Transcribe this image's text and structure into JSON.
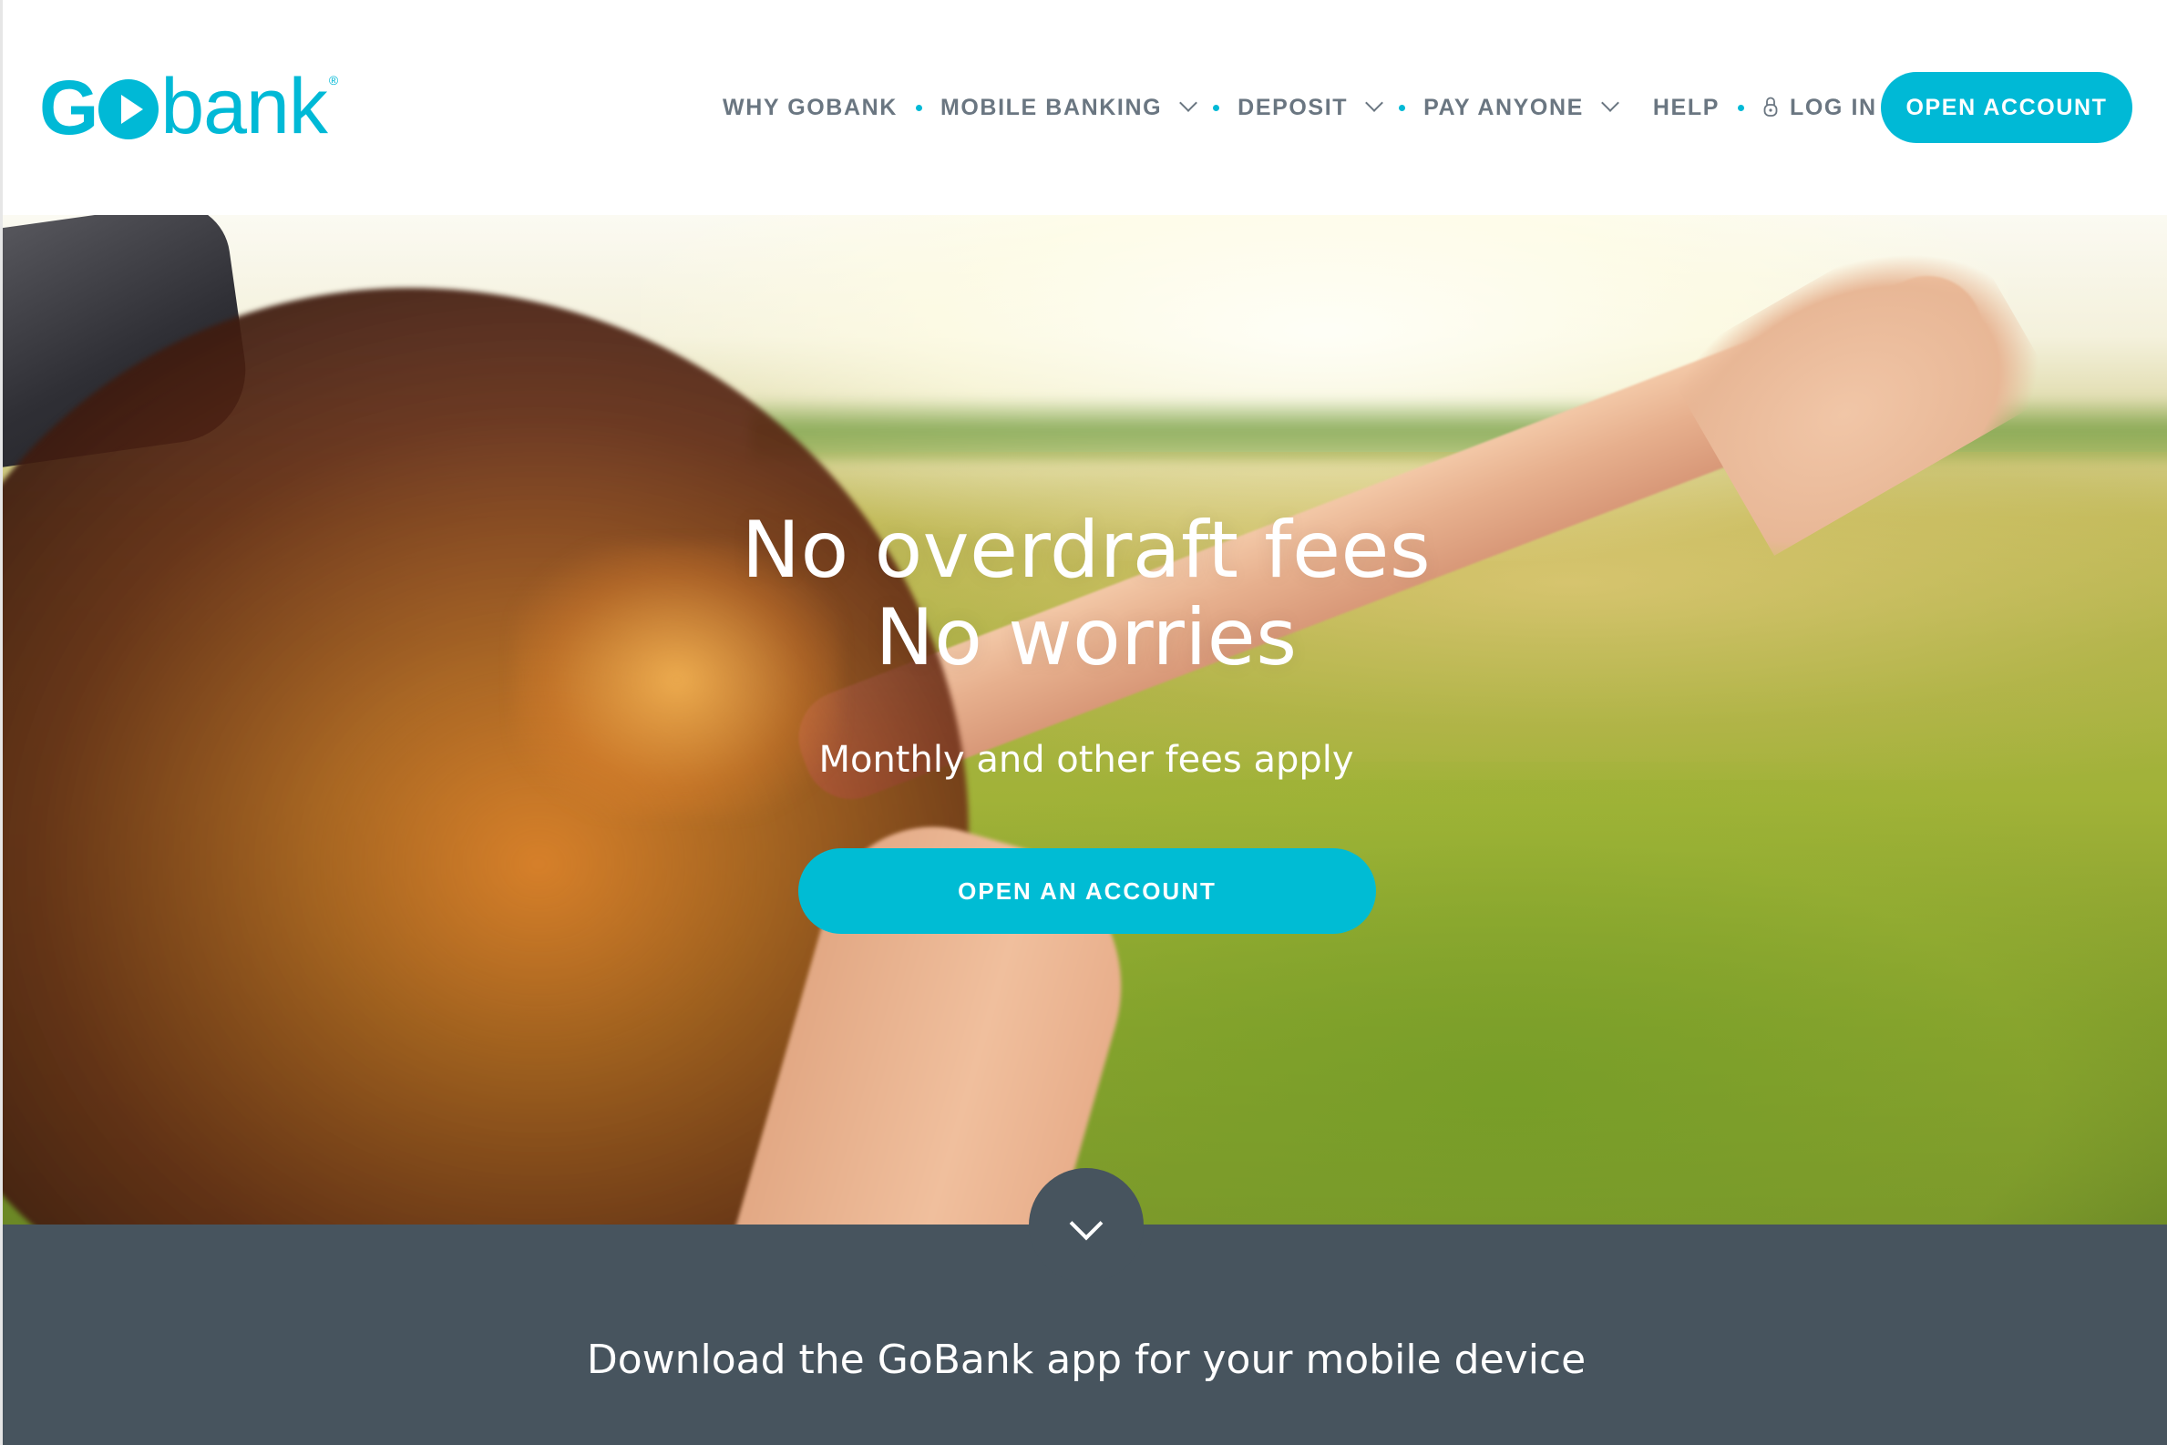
{
  "brand": {
    "logo_go": "GO",
    "logo_bank": "bank",
    "logo_reg": "®",
    "accent_color": "#00b9d6",
    "band_color": "#47545e"
  },
  "nav": {
    "items": [
      {
        "label": "WHY GOBANK",
        "dropdown": false
      },
      {
        "label": "MOBILE BANKING",
        "dropdown": true
      },
      {
        "label": "DEPOSIT",
        "dropdown": true
      },
      {
        "label": "PAY ANYONE",
        "dropdown": true
      },
      {
        "label": "HELP",
        "dropdown": false
      },
      {
        "label": "LOG IN",
        "dropdown": false,
        "icon": "lock-icon"
      }
    ],
    "open_account_label": "OPEN ACCOUNT"
  },
  "hero": {
    "headline_line1": "No overdraft fees",
    "headline_line2": "No worries",
    "subline": "Monthly and other fees apply",
    "cta_label": "OPEN AN ACCOUNT",
    "scroll_icon": "chevron-down-icon"
  },
  "band": {
    "download_text": "Download the GoBank app for your mobile device"
  }
}
